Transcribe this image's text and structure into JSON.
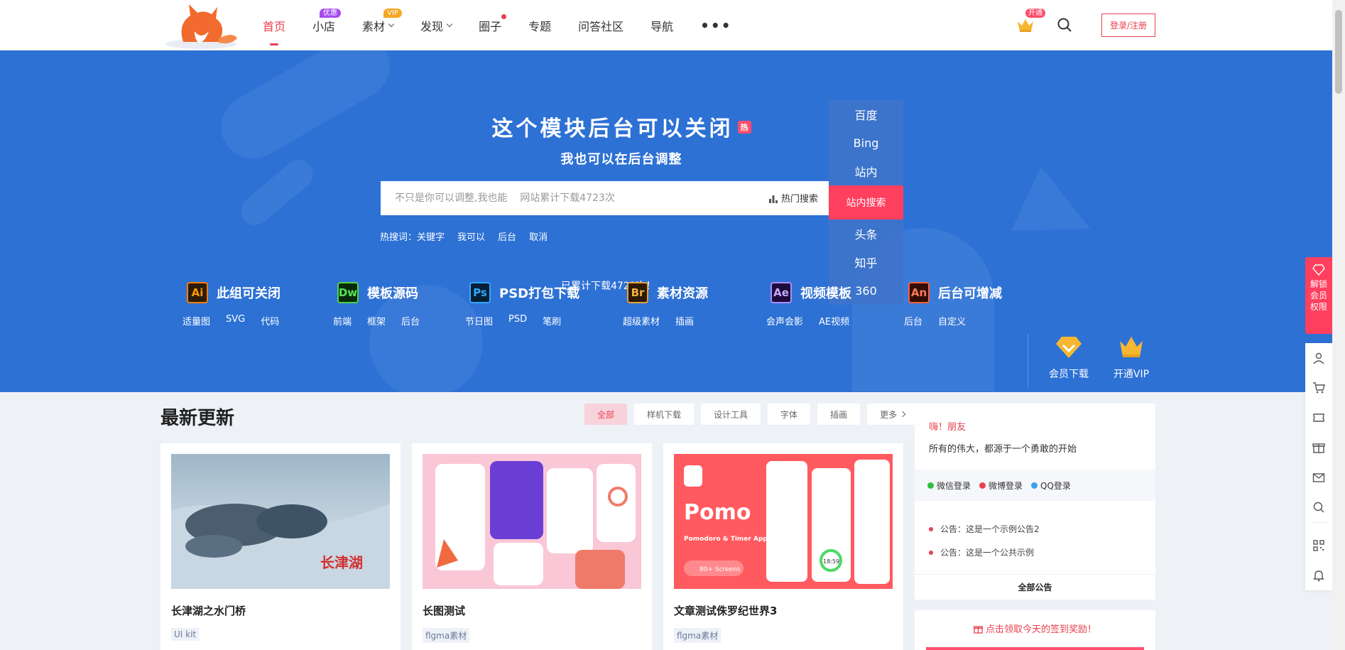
{
  "nav": {
    "items": [
      {
        "label": "首页",
        "active": true
      },
      {
        "label": "小店",
        "badge": "优惠"
      },
      {
        "label": "素材",
        "badge": "VIP",
        "dropdown": true
      },
      {
        "label": "发现",
        "dropdown": true
      },
      {
        "label": "圈子",
        "dot": true
      },
      {
        "label": "专题"
      },
      {
        "label": "问答社区"
      },
      {
        "label": "导航"
      }
    ],
    "more": "•••",
    "vip_badge": "开通",
    "login": "登录/注册"
  },
  "hero": {
    "title": "这个模块后台可以关闭",
    "hot_tag": "热",
    "subtitle": "我也可以在后台调整",
    "search_placeholder": "不只是你可以调整,我也能    网站累计下载4723次",
    "hot_search": "热门搜索",
    "engines": [
      "百度",
      "Bing",
      "站内",
      "站内搜索",
      "头条",
      "知乎",
      "360"
    ],
    "hot_words_label": "热搜词：",
    "hot_words": [
      "关键字",
      "我可以",
      "后台",
      "取消"
    ],
    "download_count": "已累计下载4723次！"
  },
  "categories": [
    {
      "icon": "Ai",
      "title": "此组可关闭",
      "links": [
        "适量图",
        "SVG",
        "代码"
      ]
    },
    {
      "icon": "Dw",
      "title": "模板源码",
      "links": [
        "前端",
        "框架",
        "后台"
      ]
    },
    {
      "icon": "Ps",
      "title": "PSD打包下载",
      "links": [
        "节日图",
        "PSD",
        "笔刷"
      ]
    },
    {
      "icon": "Br",
      "title": "素材资源",
      "links": [
        "超级素材",
        "插画"
      ]
    },
    {
      "icon": "Ae",
      "title": "视频模板",
      "links": [
        "会声会影",
        "AE视频"
      ]
    },
    {
      "icon": "An",
      "title": "后台可增减",
      "links": [
        "后台",
        "自定义"
      ]
    }
  ],
  "vip_links": [
    "会员下载",
    "开通VIP"
  ],
  "latest": {
    "title": "最新更新",
    "filters": [
      "全部",
      "样机下载",
      "设计工具",
      "字体",
      "插画",
      "更多"
    ],
    "cards": [
      {
        "title": "长津湖之水门桥",
        "tag": "UI kit",
        "image_text": "长津湖"
      },
      {
        "title": "长图测试",
        "tag": "flgma素材"
      },
      {
        "title": "文章测试侏罗纪世界3",
        "tag": "flgma素材",
        "image_text": "Pomo",
        "image_sub": "Pomodoro & Timer App UI Kit",
        "image_badge": "80+ Screens",
        "image_time": "18:59"
      }
    ]
  },
  "sidebar": {
    "greet": "嗨！朋友",
    "motto": "所有的伟大，都源于一个勇敢的开始",
    "logins": [
      "微信登录",
      "微博登录",
      "QQ登录"
    ],
    "notices": [
      "公告：这是一个示例公告2",
      "公告：这是一个公共示例"
    ],
    "all_notices": "全部公告",
    "sign": "点击领取今天的签到奖励！"
  },
  "float": {
    "unlock": [
      "解锁",
      "会员",
      "权限"
    ]
  }
}
